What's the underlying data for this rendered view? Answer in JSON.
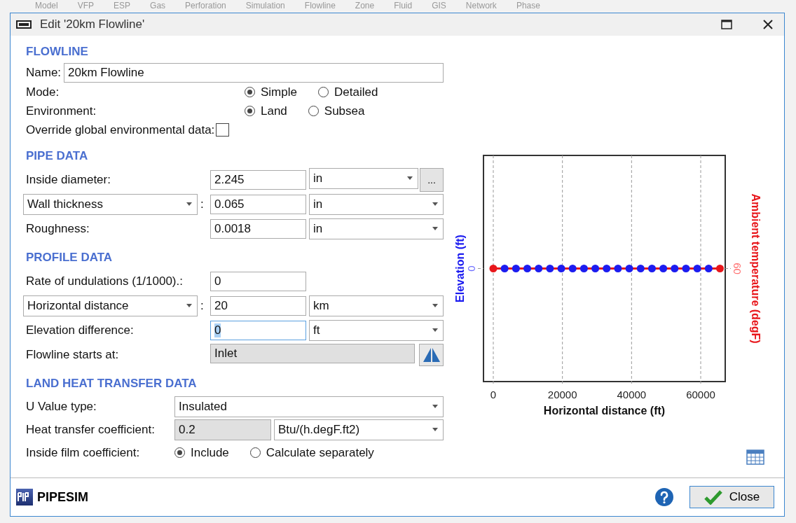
{
  "background_menu": [
    "Model",
    "VFP",
    "ESP",
    "Gas",
    "Perforation",
    "Simulation",
    "Flowline",
    "Zone",
    "Fluid",
    "GIS",
    "Network",
    "Phase"
  ],
  "window": {
    "title": "Edit '20km Flowline'"
  },
  "flowline": {
    "heading": "FLOWLINE",
    "name_label": "Name:",
    "name": "20km Flowline",
    "radio_rows": [
      {
        "label": "Mode:",
        "options": [
          {
            "label": "Simple",
            "selected": true
          },
          {
            "label": "Detailed",
            "selected": false
          }
        ]
      },
      {
        "label": "Environment:",
        "options": [
          {
            "label": "Land",
            "selected": true
          },
          {
            "label": "Subsea",
            "selected": false
          }
        ]
      }
    ],
    "override": {
      "label": "Override global environmental data:",
      "checked": false
    }
  },
  "pipe_data": {
    "heading": "PIPE DATA",
    "rows": [
      {
        "kind": "label",
        "label": "Inside diameter:",
        "value": "2.245",
        "unit": "in",
        "button": "..."
      },
      {
        "kind": "dropdown",
        "label": "Wall thickness",
        "separator": ":",
        "value": "0.065",
        "unit": "in"
      },
      {
        "kind": "label",
        "label": "Roughness:",
        "value": "0.0018",
        "unit": "in"
      }
    ]
  },
  "profile_data": {
    "heading": "PROFILE DATA",
    "rows": [
      {
        "kind": "label",
        "label": "Rate of undulations (1/1000).:",
        "value": "0"
      },
      {
        "kind": "dropdown",
        "label": "Horizontal distance",
        "separator": ":",
        "value": "20",
        "unit": "km"
      },
      {
        "kind": "label",
        "label": "Elevation difference:",
        "value": "0",
        "unit": "ft",
        "focused": true
      },
      {
        "kind": "readonly",
        "label": "Flowline starts at:",
        "value": "Inlet"
      }
    ]
  },
  "heat_transfer": {
    "heading": "LAND HEAT TRANSFER DATA",
    "rows": [
      {
        "kind": "select",
        "label": "U Value type:",
        "value": "Insulated"
      },
      {
        "kind": "readonly",
        "label": "Heat transfer coefficient:",
        "value": "0.2",
        "unit": "Btu/(h.degF.ft2)"
      },
      {
        "kind": "radio",
        "label": "Inside film coefficient:",
        "options": [
          {
            "label": "Include",
            "selected": true
          },
          {
            "label": "Calculate separately",
            "selected": false
          }
        ]
      }
    ]
  },
  "chart": {
    "x_title": "Horizontal distance (ft)",
    "left_title": "Elevation (ft)",
    "right_title": "Ambient temperature (degF)",
    "left_tick": "0",
    "right_tick": "60",
    "x_ticks": [
      "0",
      "20000",
      "40000",
      "60000"
    ]
  },
  "footer": {
    "brand": "PIPESIM",
    "close_button": "Close"
  }
}
